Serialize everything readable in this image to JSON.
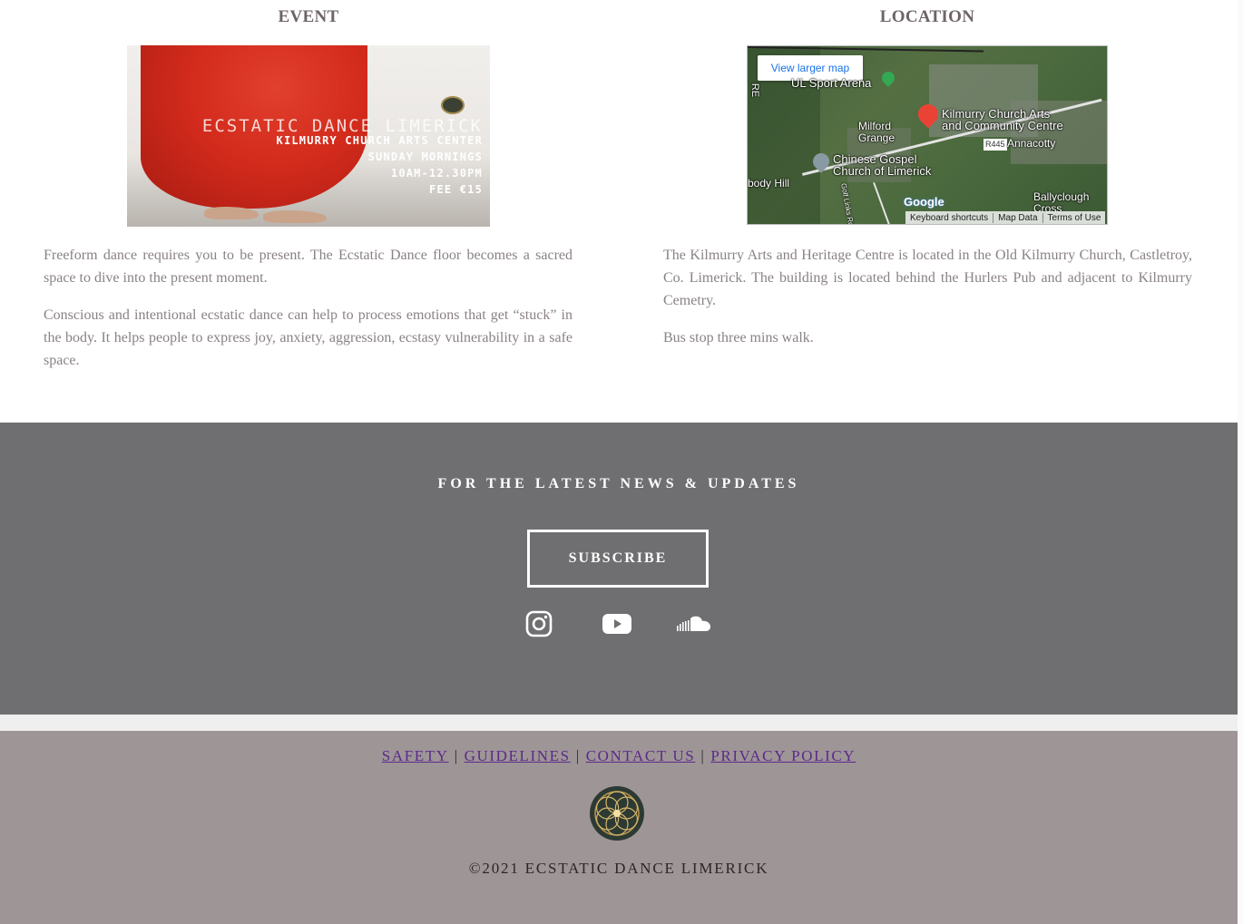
{
  "event": {
    "title": "EVENT",
    "flyer": {
      "title": "ECSTATIC DANCE LIMERICK",
      "line1": "KILMURRY CHURCH ARTS CENTER",
      "line2": "SUNDAY MORNINGS",
      "line3": "10AM-12.30PM",
      "line4": "FEE €15"
    },
    "paragraphs": [
      "Freeform dance requires you to be present. The Ecstatic Dance floor becomes a sacred space to dive into the present moment.",
      "Conscious and intentional ecstatic dance can help to process emotions that get “stuck” in the body. It helps people to express joy, anxiety, aggression, ecstasy vulnerability in a safe space."
    ]
  },
  "location": {
    "title": "LOCATION",
    "map": {
      "view_larger": "View larger map",
      "labels": {
        "ul_sport": "UL Sport Arena",
        "milford": "Milford\nGrange",
        "kilmurry": "Kilmurry Church Arts\nand Community Centre",
        "annacotty": "Annacotty",
        "road": "R445",
        "chinese": "Chinese Gospel\nChurch of Limerick",
        "body_hill": "body Hill",
        "golf": "Golf Links Rd",
        "ballyclough": "Ballyclough\nCross",
        "re": "RE",
        "google": "Google"
      },
      "footer": [
        "Keyboard shortcuts",
        "Map Data",
        "Terms of Use"
      ]
    },
    "paragraphs": [
      "The Kilmurry Arts and Heritage Centre is located in the Old Kilmurry Church, Castletroy, Co. Limerick. The building is located behind the Hurlers Pub and adjacent to Kilmurry Cemetry.",
      "Bus stop three mins walk."
    ]
  },
  "newsletter": {
    "title": "FOR THE LATEST NEWS & UPDATES",
    "subscribe_label": "SUBSCRIBE",
    "social": [
      "instagram-icon",
      "youtube-icon",
      "soundcloud-icon"
    ]
  },
  "footer": {
    "links": [
      "SAFETY",
      "GUIDELINES",
      "CONTACT US",
      "PRIVACY POLICY"
    ],
    "separator": "|",
    "copyright": "©2021 ECSTATIC DANCE LIMERICK"
  },
  "colors": {
    "news_band": "#6f6e70",
    "footer_band": "#9e9597",
    "link": "#5b2a8a",
    "body_text": "#8a8284"
  }
}
